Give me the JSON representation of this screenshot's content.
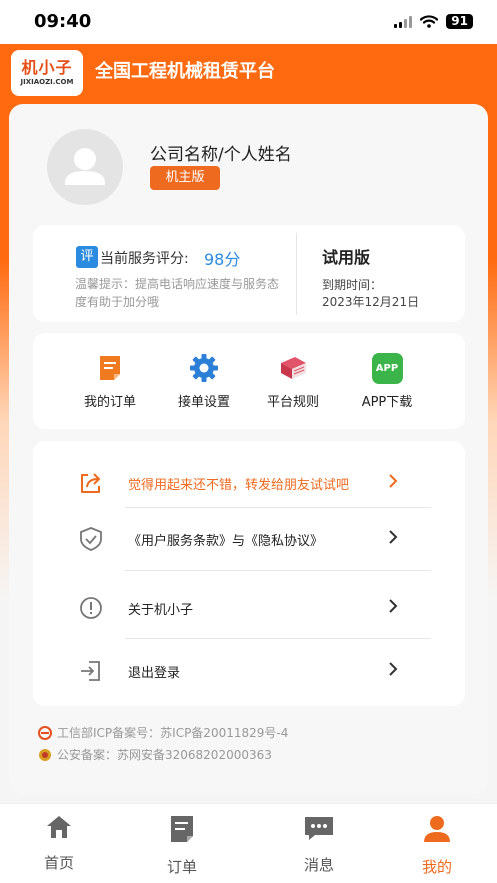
{
  "status_bar": {
    "time": "09:40",
    "battery": "91"
  },
  "header": {
    "logo_text": "机小子",
    "logo_sub": "JIXIAOZI.COM",
    "title": "全国工程机械租赁平台"
  },
  "profile": {
    "name": "公司名称/个人姓名",
    "badge": "机主版"
  },
  "score_card": {
    "badge": "评",
    "label": "当前服务评分:",
    "value": "98分",
    "tip": "温馨提示：提高电话响应速度与服务态度有助于加分哦",
    "plan": "试用版",
    "expire_label": "到期时间：",
    "expire_date": "2023年12月21日"
  },
  "menu": [
    {
      "label": "我的订单",
      "icon": "order-icon"
    },
    {
      "label": "接单设置",
      "icon": "gear-icon"
    },
    {
      "label": "平台规则",
      "icon": "book-icon"
    },
    {
      "label": "APP下载",
      "icon": "app-icon",
      "icon_text": "APP"
    }
  ],
  "list": [
    {
      "label": "觉得用起来还不错，转发给朋友试试吧",
      "icon": "share-icon",
      "accent": true
    },
    {
      "label": "《用户服务条款》与《隐私协议》",
      "icon": "shield-icon"
    },
    {
      "label": "关于机小子",
      "icon": "info-icon"
    },
    {
      "label": "退出登录",
      "icon": "logout-icon"
    }
  ],
  "footer": {
    "icp": "工信部ICP备案号：苏ICP备20011829号-4",
    "police": "公安备案：苏网安备32068202000363"
  },
  "tabs": [
    {
      "label": "首页",
      "icon": "home-icon"
    },
    {
      "label": "订单",
      "icon": "order-tab-icon"
    },
    {
      "label": "消息",
      "icon": "message-icon"
    },
    {
      "label": "我的",
      "icon": "user-icon",
      "active": true
    }
  ],
  "colors": {
    "brand": "#ee6a1e",
    "blue": "#2b8be0",
    "red": "#d83a4a",
    "green": "#3bb54a"
  }
}
